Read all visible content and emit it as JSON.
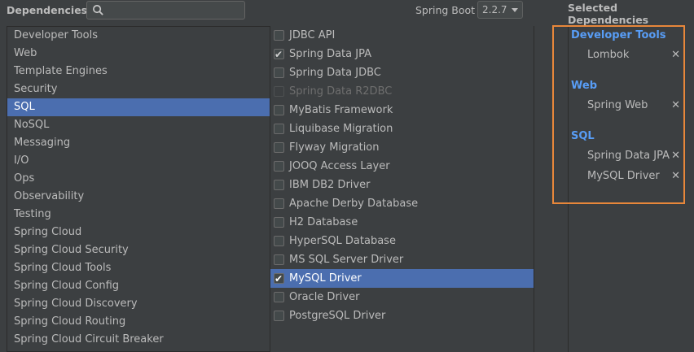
{
  "header": {
    "title": "Dependencies",
    "search": {
      "value": "",
      "placeholder": ""
    },
    "spring_boot_label": "Spring Boot",
    "spring_boot_version": "2.2.7",
    "selected_title": "Selected Dependencies"
  },
  "categories": [
    {
      "label": "Developer Tools"
    },
    {
      "label": "Web"
    },
    {
      "label": "Template Engines"
    },
    {
      "label": "Security"
    },
    {
      "label": "SQL",
      "active": true
    },
    {
      "label": "NoSQL"
    },
    {
      "label": "Messaging"
    },
    {
      "label": "I/O"
    },
    {
      "label": "Ops"
    },
    {
      "label": "Observability"
    },
    {
      "label": "Testing"
    },
    {
      "label": "Spring Cloud"
    },
    {
      "label": "Spring Cloud Security"
    },
    {
      "label": "Spring Cloud Tools"
    },
    {
      "label": "Spring Cloud Config"
    },
    {
      "label": "Spring Cloud Discovery"
    },
    {
      "label": "Spring Cloud Routing"
    },
    {
      "label": "Spring Cloud Circuit Breaker"
    }
  ],
  "dependencies": [
    {
      "label": "JDBC API",
      "checked": false
    },
    {
      "label": "Spring Data JPA",
      "checked": true
    },
    {
      "label": "Spring Data JDBC",
      "checked": false
    },
    {
      "label": "Spring Data R2DBC",
      "checked": false,
      "disabled": true
    },
    {
      "label": "MyBatis Framework",
      "checked": false
    },
    {
      "label": "Liquibase Migration",
      "checked": false
    },
    {
      "label": "Flyway Migration",
      "checked": false
    },
    {
      "label": "JOOQ Access Layer",
      "checked": false
    },
    {
      "label": "IBM DB2 Driver",
      "checked": false
    },
    {
      "label": "Apache Derby Database",
      "checked": false
    },
    {
      "label": "H2 Database",
      "checked": false
    },
    {
      "label": "HyperSQL Database",
      "checked": false
    },
    {
      "label": "MS SQL Server Driver",
      "checked": false
    },
    {
      "label": "MySQL Driver",
      "checked": true,
      "active": true
    },
    {
      "label": "Oracle Driver",
      "checked": false
    },
    {
      "label": "PostgreSQL Driver",
      "checked": false
    }
  ],
  "selected": {
    "groups": [
      {
        "title": "Developer Tools",
        "items": [
          "Lombok"
        ]
      },
      {
        "title": "Web",
        "items": [
          "Spring Web"
        ]
      },
      {
        "title": "SQL",
        "items": [
          "Spring Data JPA",
          "MySQL Driver"
        ]
      }
    ],
    "remove_glyph": "✕"
  },
  "colors": {
    "accent": "#4b6eaf",
    "group_title": "#589df6",
    "highlight_border": "#e8873a",
    "background": "#3c3f41"
  }
}
